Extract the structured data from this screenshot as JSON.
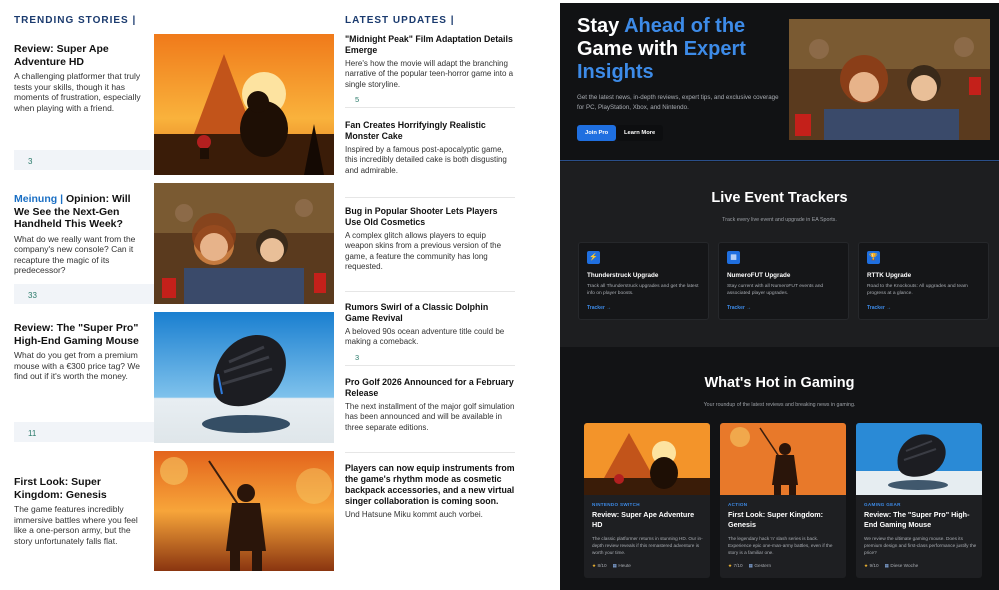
{
  "left": {
    "trending_heading": "TRENDING STORIES |",
    "updates_heading": "LATEST UPDATES |",
    "stories": [
      {
        "kicker": "",
        "title": "Review: Super Ape Adventure HD",
        "desc": "A challenging platformer that truly tests your skills, though it has moments of frustration, especially when playing with a friend.",
        "comments": "3"
      },
      {
        "kicker": "Meinung | ",
        "title": "Opinion: Will We See the Next-Gen Handheld This Week?",
        "desc": "What do we really want from the company's new console? Can it recapture the magic of its predecessor?",
        "comments": "33"
      },
      {
        "kicker": "",
        "title": "Review: The \"Super Pro\" High-End Gaming Mouse",
        "desc": "What do you get from a premium mouse with a €300 price tag? We find out if it's worth the money.",
        "comments": "11"
      },
      {
        "kicker": "",
        "title": "First Look: Super Kingdom: Genesis",
        "desc": "The game features incredibly immersive battles where you feel like a one-person army, but the story unfortunately falls flat.",
        "comments": ""
      }
    ],
    "updates": [
      {
        "title": "\"Midnight Peak\" Film Adaptation Details Emerge",
        "desc": "Here's how the movie will adapt the branching narrative of the popular teen-horror game into a single storyline.",
        "count": "5"
      },
      {
        "title": "Fan Creates Horrifyingly Realistic Monster Cake",
        "desc": "Inspired by a famous post-apocalyptic game, this incredibly detailed cake is both disgusting and admirable.",
        "count": ""
      },
      {
        "title": "Bug in Popular Shooter Lets Players Use Old Cosmetics",
        "desc": "A complex glitch allows players to equip weapon skins from a previous version of the game, a feature the community has long requested.",
        "count": ""
      },
      {
        "title": "Rumors Swirl of a Classic Dolphin Game Revival",
        "desc": "A beloved 90s ocean adventure title could be making a comeback.",
        "count": "3"
      },
      {
        "title": "Pro Golf 2026 Announced for a February Release",
        "desc": "The next installment of the major golf simulation has been announced and will be available in three separate editions.",
        "count": ""
      },
      {
        "title": "Players can now equip instruments from the game's rhythm mode as cosmetic backpack accessories, and a new virtual singer collaboration is coming soon.",
        "desc": "Und Hatsune Miku kommt auch vorbei.",
        "count": ""
      }
    ]
  },
  "right": {
    "hero": {
      "title_plain_1": "Stay ",
      "title_accent_1": "Ahead of the",
      "title_plain_2": "Game with ",
      "title_accent_2": "Expert Insights",
      "subtitle": "Get the latest news, in-depth reviews, expert tips, and exclusive coverage for PC, PlayStation, Xbox, and Nintendo.",
      "btn_primary": "Join Pro",
      "btn_secondary": "Learn More"
    },
    "trackers": {
      "title": "Live Event Trackers",
      "subtitle": "Track every live event and upgrade in EA Sports.",
      "cards": [
        {
          "icon": "bolt-icon",
          "glyph": "⚡",
          "name": "Thunderstruck Upgrade",
          "desc": "Track all Thunderstruck upgrades and get the latest info on player boosts.",
          "link": "Tracker →"
        },
        {
          "icon": "grid-icon",
          "glyph": "▦",
          "name": "NumeroFUT Upgrade",
          "desc": "Stay current with all NumeroFUT events and associated player upgrades.",
          "link": "Tracker →"
        },
        {
          "icon": "trophy-icon",
          "glyph": "🏆",
          "name": "RTTK Upgrade",
          "desc": "Road to the Knockouts: All upgrades and team progress at a glance.",
          "link": "Tracker →"
        }
      ]
    },
    "hot": {
      "title": "What's Hot in Gaming",
      "subtitle": "Your roundup of the latest reviews and breaking news in gaming.",
      "cards": [
        {
          "category": "NINTENDO SWITCH",
          "title": "Review: Super Ape Adventure HD",
          "desc": "The classic platformer returns in stunning HD. Our in-depth review reveals if this remastered adventure is worth your time.",
          "rating": "8/10",
          "date": "Heute"
        },
        {
          "category": "ACTION",
          "title": "First Look: Super Kingdom: Genesis",
          "desc": "The legendary hack 'n' slash series is back. Experience epic one-man-army battles, even if the story is a familiar one.",
          "rating": "7/10",
          "date": "Gestern"
        },
        {
          "category": "GAMING GEAR",
          "title": "Review: The \"Super Pro\" High-End Gaming Mouse",
          "desc": "We review the ultimate gaming mouse. Does its premium design and first-class performance justify the price?",
          "rating": "9/10",
          "date": "Diese Woche"
        }
      ]
    }
  },
  "colors": {
    "accent": "#3d8be8",
    "headline_blue": "#1a3a6e",
    "comment_green": "#2a7a6a",
    "dark_bg": "#161718"
  }
}
